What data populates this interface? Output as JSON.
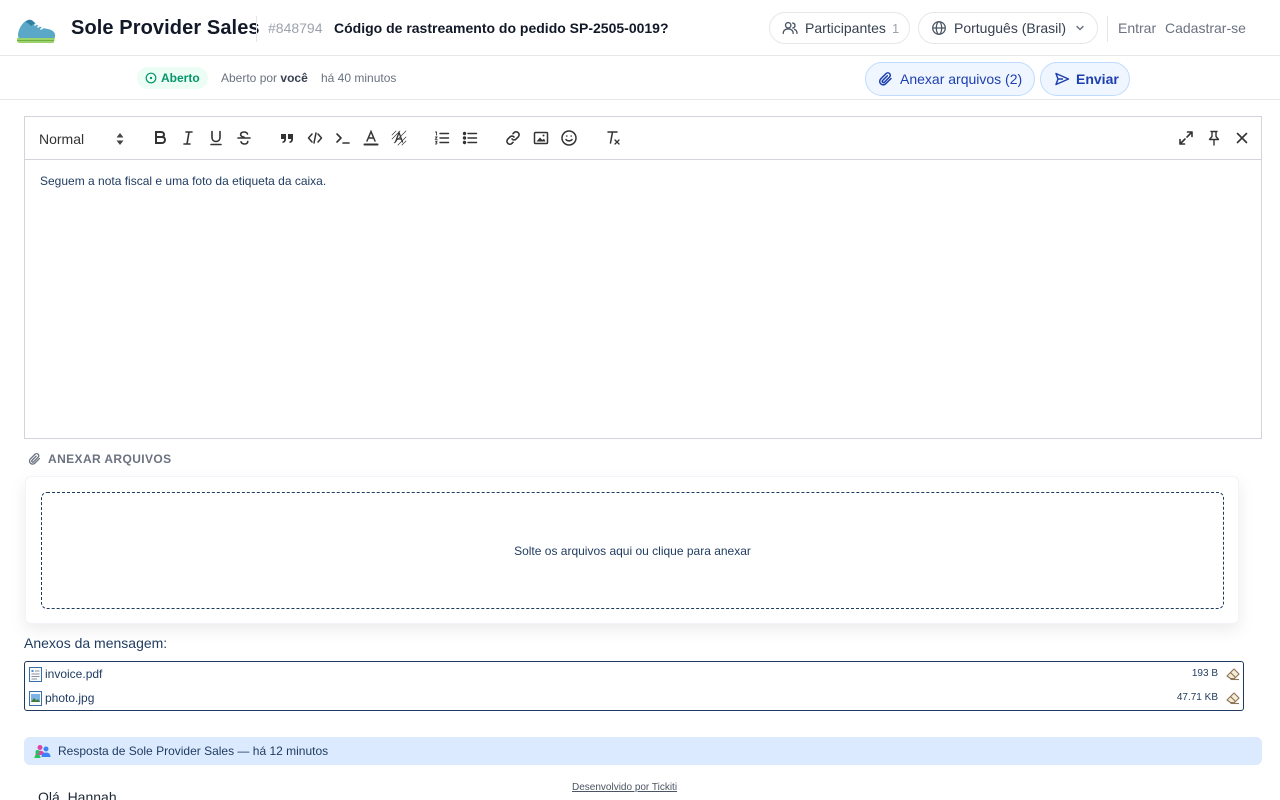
{
  "header": {
    "brand": "Sole Provider Sales",
    "ticket_id": "#848794",
    "ticket_title": "Código de rastreamento do pedido SP-2505-0019?",
    "participants_label": "Participantes",
    "participants_count": "1",
    "language": "Português (Brasil)",
    "login": "Entrar",
    "signup": "Cadastrar-se"
  },
  "subheader": {
    "status": "Aberto",
    "opened_by_prefix": "Aberto por",
    "opened_by_user": "você",
    "opened_time": "há 40 minutos",
    "attach_button": "Anexar arquivos (2)",
    "send_button": "Enviar"
  },
  "editor": {
    "format": "Normal",
    "body": "Seguem a nota fiscal e uma foto da etiqueta da caixa."
  },
  "attach_section": {
    "heading": "ANEXAR ARQUIVOS",
    "dropzone_text": "Solte os arquivos aqui ou clique para anexar"
  },
  "attachments": {
    "title": "Anexos da mensagem:",
    "files": [
      {
        "name": "invoice.pdf",
        "size": "193 B"
      },
      {
        "name": "photo.jpg",
        "size": "47.71 KB"
      }
    ]
  },
  "reply": {
    "header": "Resposta de Sole Provider Sales — há 12 minutos",
    "greeting": "Olá, Hannah,"
  },
  "footer": {
    "credit": "Desenvolvido por Tickiti"
  },
  "colors": {
    "accent": "#1e40af",
    "accent_bg": "#eff6ff",
    "status_green": "#059669",
    "navy_text": "#1e3a5f",
    "reply_bg": "#dbeafe"
  }
}
